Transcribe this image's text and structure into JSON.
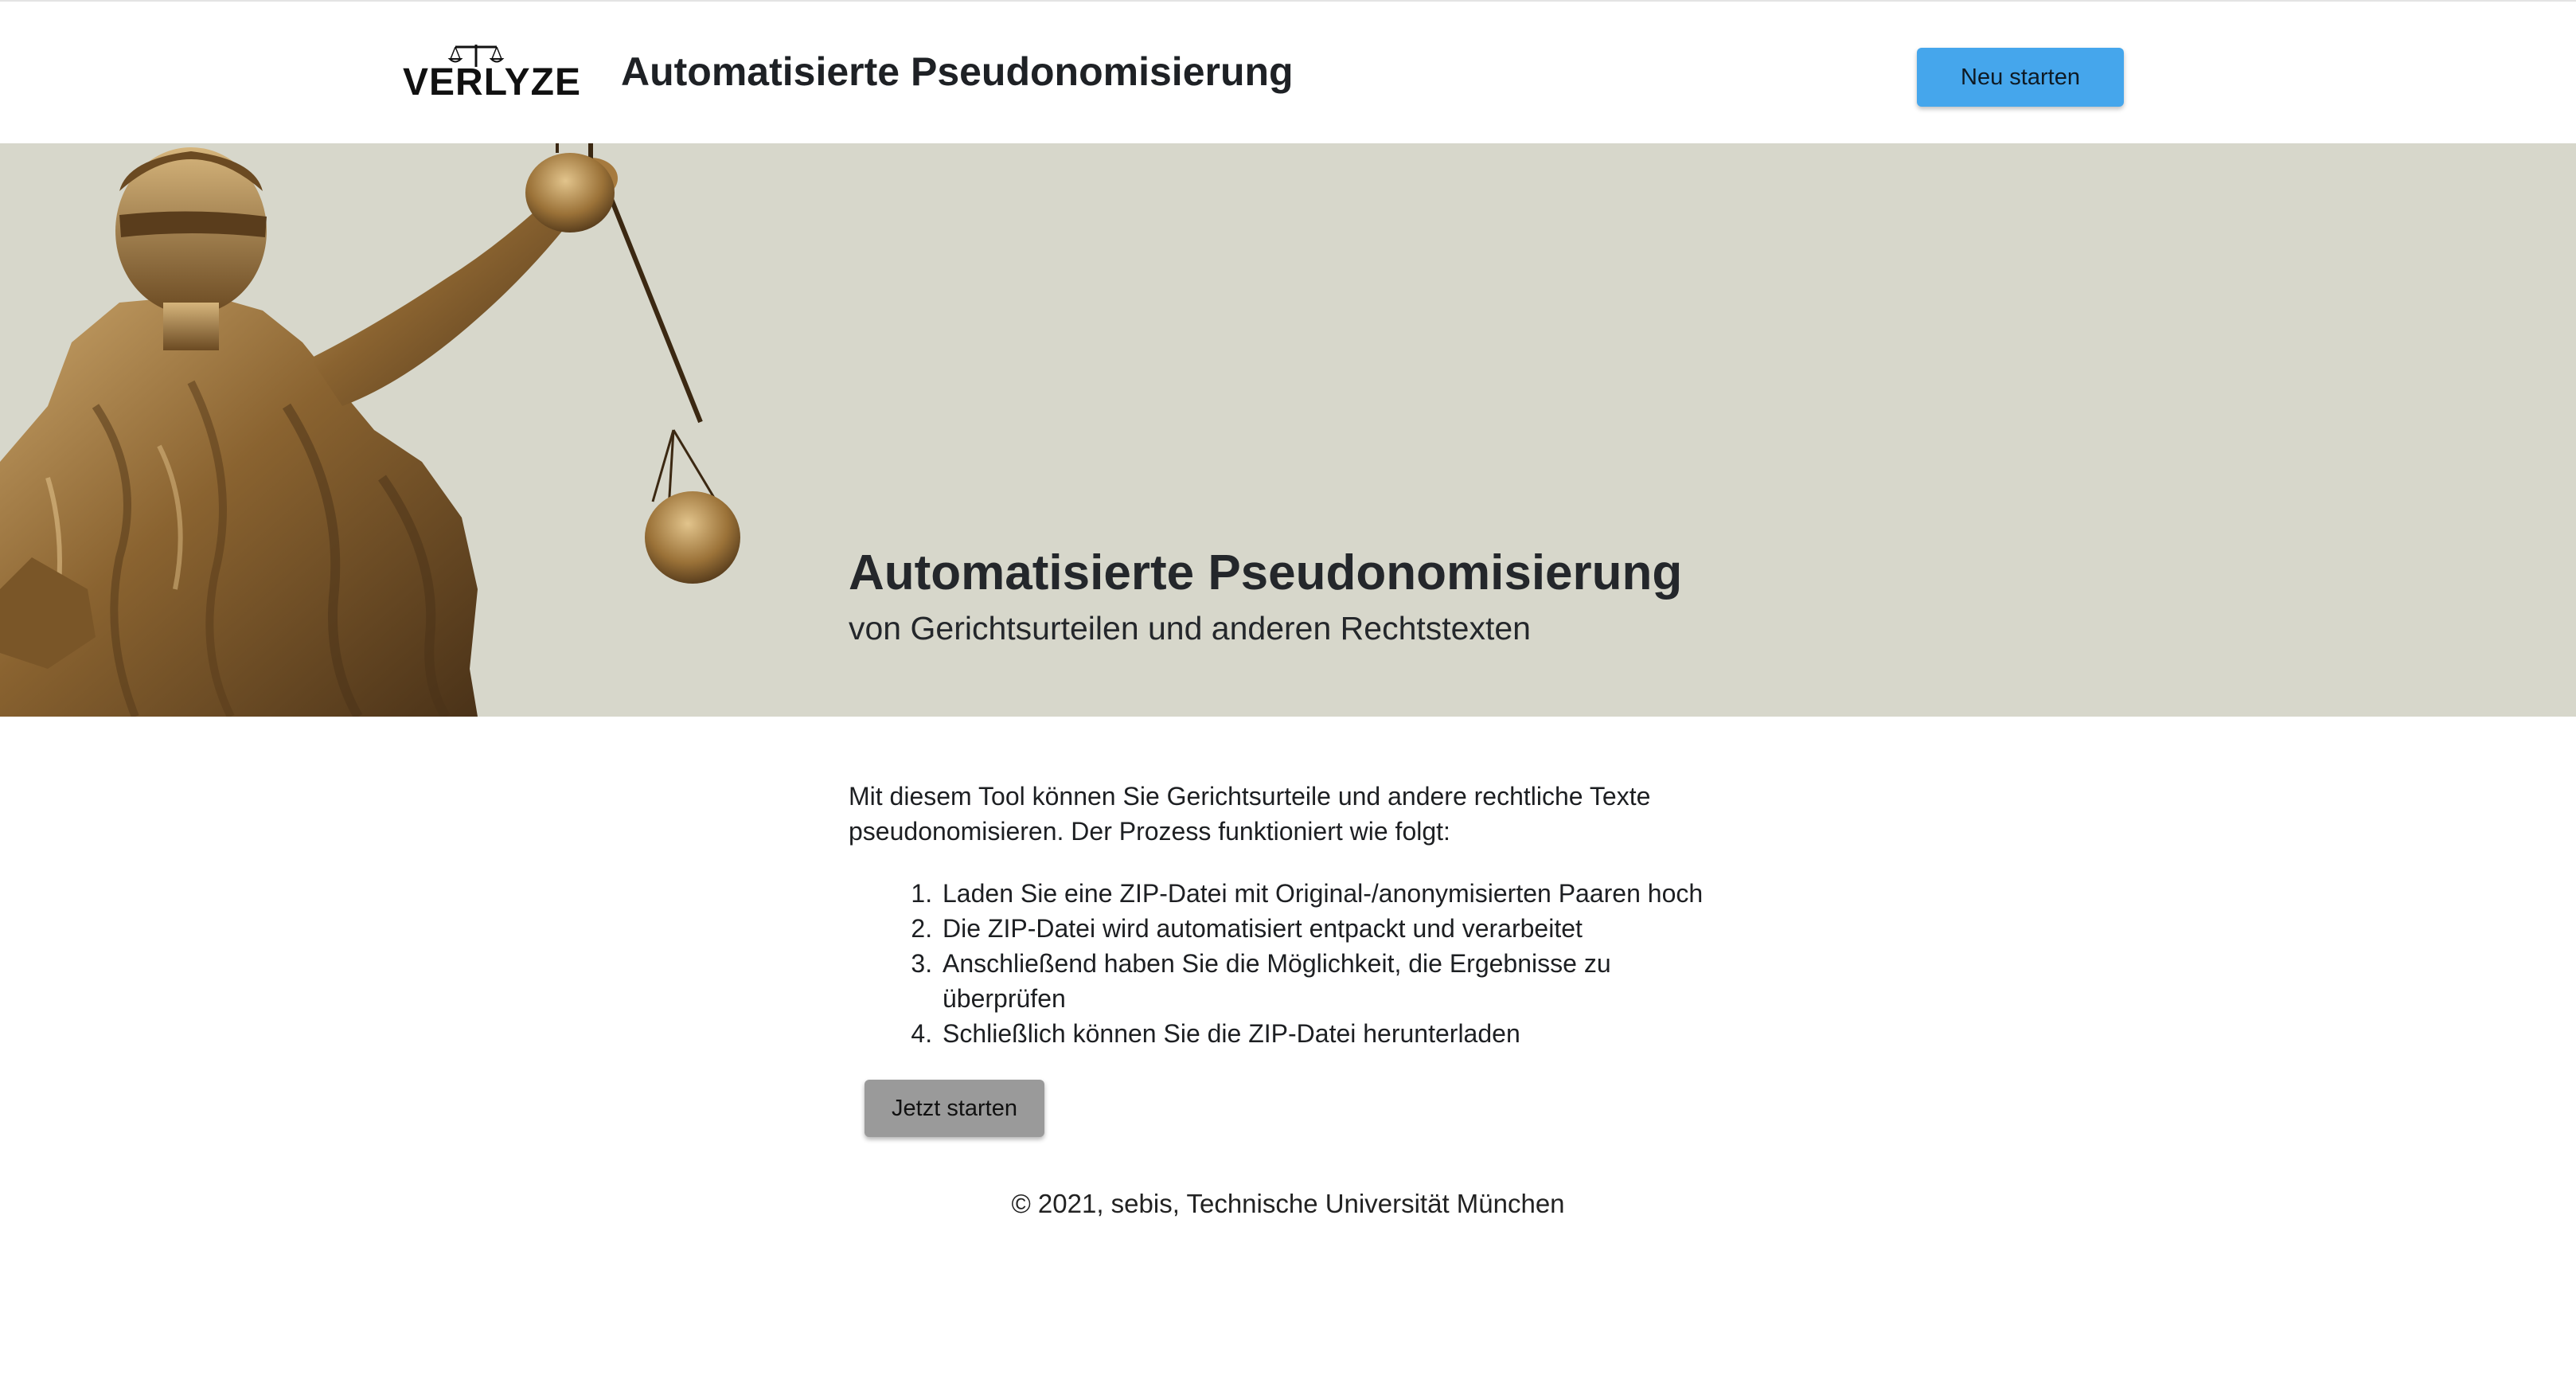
{
  "header": {
    "logo_text": "VERLYZE",
    "title": "Automatisierte Pseudonomisierung",
    "restart_label": "Neu starten"
  },
  "hero": {
    "title": "Automatisierte Pseudonomisierung",
    "subtitle": "von Gerichtsurteilen und anderen Rechtstexten"
  },
  "main": {
    "intro": "Mit diesem Tool können Sie Gerichtsurteile und andere rechtliche Texte pseudonomisieren. Der Prozess funktioniert wie folgt:",
    "steps": [
      "Laden Sie eine ZIP-Datei mit Original-/anonymisierten Paaren hoch",
      "Die ZIP-Datei wird automatisiert entpackt und verarbeitet",
      "Anschließend haben Sie die Möglichkeit, die Ergebnisse zu überprüfen",
      "Schließlich können Sie die ZIP-Datei herunterladen"
    ],
    "start_label": "Jetzt starten"
  },
  "footer": {
    "copyright": "© 2021, sebis, Technische Universität München"
  },
  "colors": {
    "accent": "#45a6ec",
    "hero_background": "#d7d7cb",
    "start_button": "#9a9a9a"
  },
  "icons": {
    "logo": "scales-icon",
    "hero": "justitia-statue-image"
  }
}
